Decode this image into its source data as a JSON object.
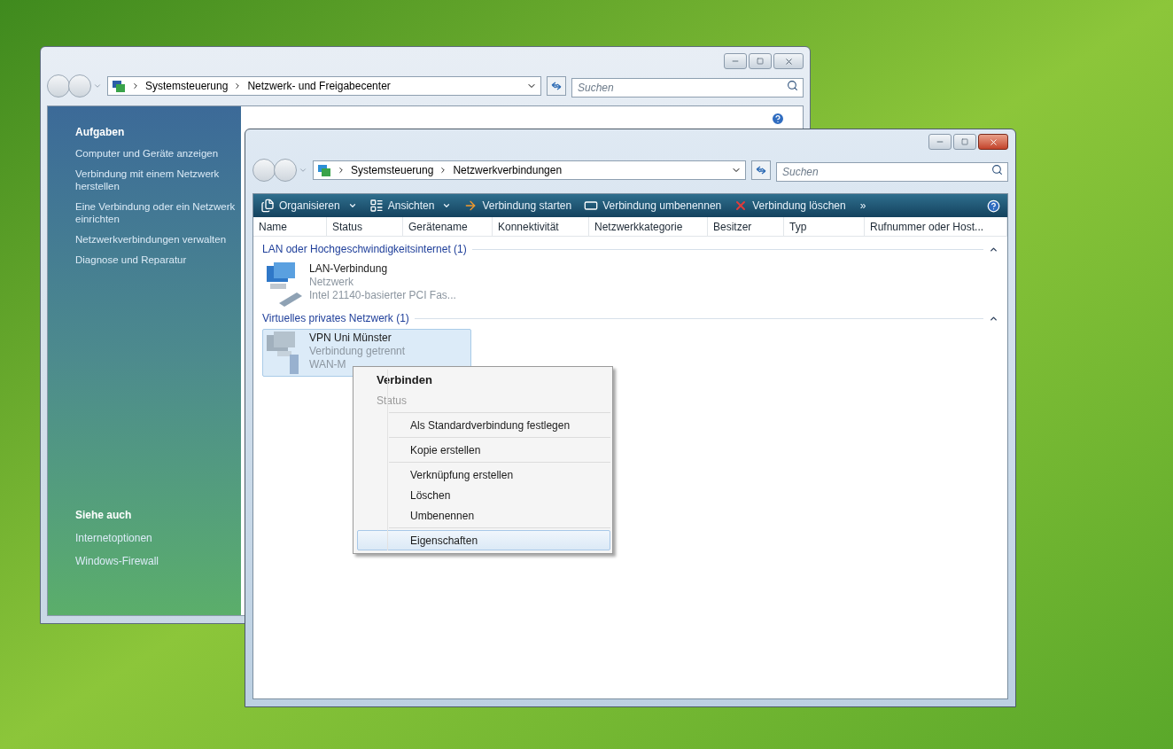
{
  "back_window": {
    "breadcrumb": [
      "Systemsteuerung",
      "Netzwerk- und Freigabecenter"
    ],
    "search": {
      "placeholder": "Suchen"
    },
    "sidebar": {
      "tasks_heading": "Aufgaben",
      "tasks": [
        "Computer und Geräte anzeigen",
        "Verbindung mit einem Netzwerk herstellen",
        "Eine Verbindung oder ein Netzwerk einrichten",
        "Netzwerkverbindungen verwalten",
        "Diagnose und Reparatur"
      ],
      "see_also_heading": "Siehe auch",
      "see_also": [
        "Internetoptionen",
        "Windows-Firewall"
      ]
    }
  },
  "front_window": {
    "breadcrumb": [
      "Systemsteuerung",
      "Netzwerkverbindungen"
    ],
    "search": {
      "placeholder": "Suchen"
    },
    "toolbar": [
      {
        "label": "Organisieren",
        "kind": "menu"
      },
      {
        "label": "Ansichten",
        "kind": "menu"
      },
      {
        "label": "Verbindung starten",
        "kind": "action"
      },
      {
        "label": "Verbindung umbenennen",
        "kind": "action"
      },
      {
        "label": "Verbindung löschen",
        "kind": "action"
      }
    ],
    "toolbar_overflow": "»",
    "columns": [
      "Name",
      "Status",
      "Gerätename",
      "Konnektivität",
      "Netzwerkkategorie",
      "Besitzer",
      "Typ",
      "Rufnummer oder Host..."
    ],
    "groups": [
      {
        "title": "LAN oder Hochgeschwindigkeitsinternet (1)",
        "expanded": true,
        "items": [
          {
            "name": "LAN-Verbindung",
            "lines": [
              "Netzwerk",
              "Intel 21140-basierter PCI Fas..."
            ],
            "selected": false,
            "kind": "lan"
          }
        ]
      },
      {
        "title": "Virtuelles privates Netzwerk (1)",
        "expanded": true,
        "items": [
          {
            "name": "VPN Uni Münster",
            "lines": [
              "Verbindung getrennt",
              "WAN-M"
            ],
            "selected": true,
            "kind": "vpn"
          }
        ]
      }
    ]
  },
  "context_menu": {
    "sections": [
      [
        {
          "label": "Verbinden",
          "default": true,
          "disabled": false,
          "selected": false
        },
        {
          "label": "Status",
          "default": false,
          "disabled": true,
          "selected": false
        }
      ],
      [
        {
          "label": "Als Standardverbindung festlegen",
          "default": false,
          "disabled": false,
          "selected": false
        }
      ],
      [
        {
          "label": "Kopie erstellen",
          "default": false,
          "disabled": false,
          "selected": false
        }
      ],
      [
        {
          "label": "Verknüpfung erstellen",
          "default": false,
          "disabled": false,
          "selected": false
        },
        {
          "label": "Löschen",
          "default": false,
          "disabled": false,
          "selected": false
        },
        {
          "label": "Umbenennen",
          "default": false,
          "disabled": false,
          "selected": false
        }
      ],
      [
        {
          "label": "Eigenschaften",
          "default": false,
          "disabled": false,
          "selected": true
        }
      ]
    ]
  }
}
